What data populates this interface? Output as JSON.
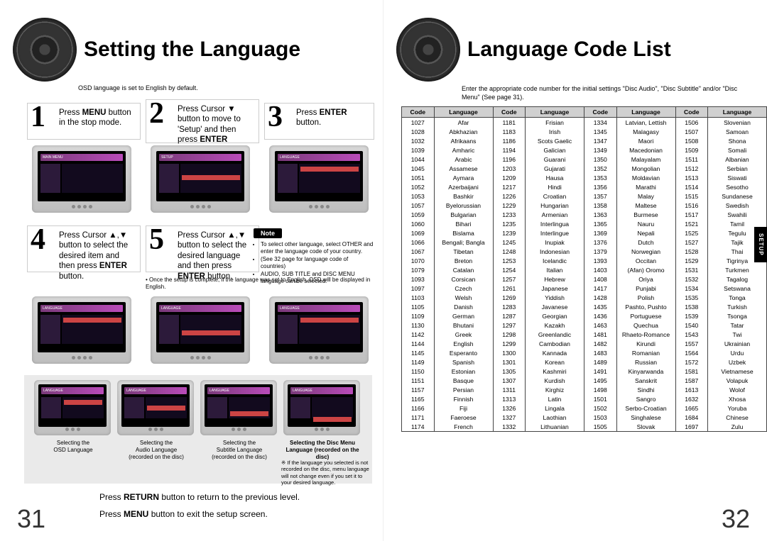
{
  "left": {
    "title": "Setting the Language",
    "subtitle": "OSD language is set to English by default.",
    "steps": {
      "s1": "Press <b>MENU</b> button in the stop mode.",
      "s2": "Press Cursor ▼ button to move to 'Setup' and then press <b>ENTER</b> button.",
      "s3": "Press <b>ENTER</b> button.",
      "s4": "Press Cursor ▲,▼ button to select the desired item and then press <b>ENTER</b> button.",
      "s5": "Press Cursor ▲,▼ button to select the desired language and then press <b>ENTER</b> button."
    },
    "noteLabel": "Note",
    "noteBullets": [
      "To select other language, select OTHER and enter the language code of your country.",
      "(See 32 page for language code of countries)",
      "AUDIO, SUB TITLE and DISC MENU language can be selected."
    ],
    "note2": "• Once the setup is complete, if the language was set to English, OSD will be displayed in English.",
    "captions": {
      "c1": "Selecting the\nOSD Language",
      "c2": "Selecting the\nAudio Language\n(recorded on the disc)",
      "c3": "Selecting the\nSubtitle Language\n(recorded on the disc)",
      "c4": "Selecting the Disc Menu\nLanguage (recorded on the disc)"
    },
    "foot4": "※ If the language you selected is not recorded on the disc, menu language will not change even if you set it to your desired language.",
    "return": "Press <b>RETURN</b> button to return to the previous level.",
    "menu": "Press <b>MENU</b> button to exit the setup screen.",
    "pageNo": "31"
  },
  "right": {
    "title": "Language Code List",
    "subtitle": "Enter the appropriate code number for the initial settings \"Disc Audio\", \"Disc Subtitle\" and/or \"Disc Menu\" (See page 31).",
    "headers": [
      "Code",
      "Language",
      "Code",
      "Language",
      "Code",
      "Language",
      "Code",
      "Language"
    ],
    "sideTab": "SETUP",
    "pageNo": "32",
    "rows": [
      [
        "1027",
        "Afar",
        "1181",
        "Frisian",
        "1334",
        "Latvian, Lettish",
        "1506",
        "Slovenian"
      ],
      [
        "1028",
        "Abkhazian",
        "1183",
        "Irish",
        "1345",
        "Malagasy",
        "1507",
        "Samoan"
      ],
      [
        "1032",
        "Afrikaans",
        "1186",
        "Scots Gaelic",
        "1347",
        "Maori",
        "1508",
        "Shona"
      ],
      [
        "1039",
        "Amharic",
        "1194",
        "Galician",
        "1349",
        "Macedonian",
        "1509",
        "Somali"
      ],
      [
        "1044",
        "Arabic",
        "1196",
        "Guarani",
        "1350",
        "Malayalam",
        "1511",
        "Albanian"
      ],
      [
        "1045",
        "Assamese",
        "1203",
        "Gujarati",
        "1352",
        "Mongolian",
        "1512",
        "Serbian"
      ],
      [
        "1051",
        "Aymara",
        "1209",
        "Hausa",
        "1353",
        "Moldavian",
        "1513",
        "Siswati"
      ],
      [
        "1052",
        "Azerbaijani",
        "1217",
        "Hindi",
        "1356",
        "Marathi",
        "1514",
        "Sesotho"
      ],
      [
        "1053",
        "Bashkir",
        "1226",
        "Croatian",
        "1357",
        "Malay",
        "1515",
        "Sundanese"
      ],
      [
        "1057",
        "Byelorussian",
        "1229",
        "Hungarian",
        "1358",
        "Maltese",
        "1516",
        "Swedish"
      ],
      [
        "1059",
        "Bulgarian",
        "1233",
        "Armenian",
        "1363",
        "Burmese",
        "1517",
        "Swahili"
      ],
      [
        "1060",
        "Bihari",
        "1235",
        "Interlingua",
        "1365",
        "Nauru",
        "1521",
        "Tamil"
      ],
      [
        "1069",
        "Bislama",
        "1239",
        "Interlingue",
        "1369",
        "Nepali",
        "1525",
        "Tegulu"
      ],
      [
        "1066",
        "Bengali; Bangla",
        "1245",
        "Inupiak",
        "1376",
        "Dutch",
        "1527",
        "Tajik"
      ],
      [
        "1067",
        "Tibetan",
        "1248",
        "Indonesian",
        "1379",
        "Norwegian",
        "1528",
        "Thai"
      ],
      [
        "1070",
        "Breton",
        "1253",
        "Icelandic",
        "1393",
        "Occitan",
        "1529",
        "Tigrinya"
      ],
      [
        "1079",
        "Catalan",
        "1254",
        "Italian",
        "1403",
        "(Afan) Oromo",
        "1531",
        "Turkmen"
      ],
      [
        "1093",
        "Corsican",
        "1257",
        "Hebrew",
        "1408",
        "Oriya",
        "1532",
        "Tagalog"
      ],
      [
        "1097",
        "Czech",
        "1261",
        "Japanese",
        "1417",
        "Punjabi",
        "1534",
        "Setswana"
      ],
      [
        "1103",
        "Welsh",
        "1269",
        "Yiddish",
        "1428",
        "Polish",
        "1535",
        "Tonga"
      ],
      [
        "1105",
        "Danish",
        "1283",
        "Javanese",
        "1435",
        "Pashto, Pushto",
        "1538",
        "Turkish"
      ],
      [
        "1109",
        "German",
        "1287",
        "Georgian",
        "1436",
        "Portuguese",
        "1539",
        "Tsonga"
      ],
      [
        "1130",
        "Bhutani",
        "1297",
        "Kazakh",
        "1463",
        "Quechua",
        "1540",
        "Tatar"
      ],
      [
        "1142",
        "Greek",
        "1298",
        "Greenlandic",
        "1481",
        "Rhaeto-Romance",
        "1543",
        "Twi"
      ],
      [
        "1144",
        "English",
        "1299",
        "Cambodian",
        "1482",
        "Kirundi",
        "1557",
        "Ukrainian"
      ],
      [
        "1145",
        "Esperanto",
        "1300",
        "Kannada",
        "1483",
        "Romanian",
        "1564",
        "Urdu"
      ],
      [
        "1149",
        "Spanish",
        "1301",
        "Korean",
        "1489",
        "Russian",
        "1572",
        "Uzbek"
      ],
      [
        "1150",
        "Estonian",
        "1305",
        "Kashmiri",
        "1491",
        "Kinyarwanda",
        "1581",
        "Vietnamese"
      ],
      [
        "1151",
        "Basque",
        "1307",
        "Kurdish",
        "1495",
        "Sanskrit",
        "1587",
        "Volapuk"
      ],
      [
        "1157",
        "Persian",
        "1311",
        "Kirghiz",
        "1498",
        "Sindhi",
        "1613",
        "Wolof"
      ],
      [
        "1165",
        "Finnish",
        "1313",
        "Latin",
        "1501",
        "Sangro",
        "1632",
        "Xhosa"
      ],
      [
        "1166",
        "Fiji",
        "1326",
        "Lingala",
        "1502",
        "Serbo-Croatian",
        "1665",
        "Yoruba"
      ],
      [
        "1171",
        "Faeroese",
        "1327",
        "Laothian",
        "1503",
        "Singhalese",
        "1684",
        "Chinese"
      ],
      [
        "1174",
        "French",
        "1332",
        "Lithuanian",
        "1505",
        "Slovak",
        "1697",
        "Zulu"
      ]
    ]
  }
}
